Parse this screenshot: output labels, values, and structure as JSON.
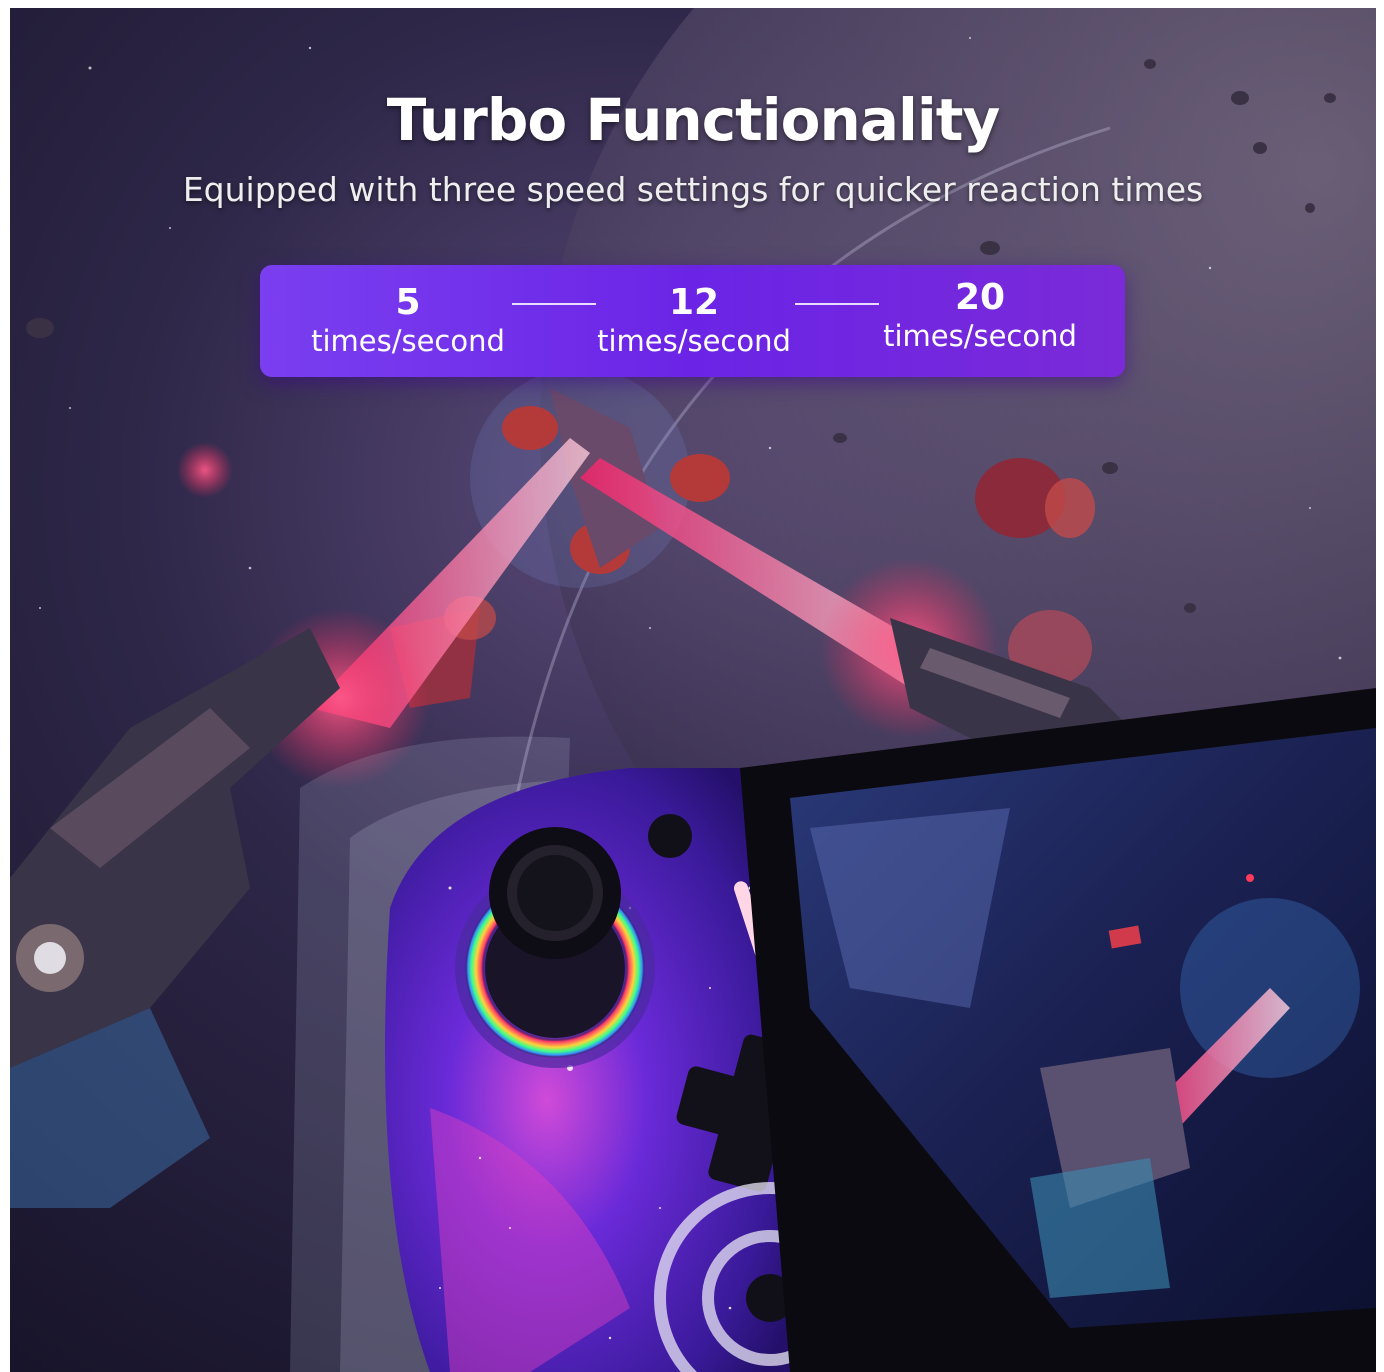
{
  "header": {
    "title": "Turbo Functionality",
    "subtitle": "Equipped with three speed settings for quicker reaction times"
  },
  "speed_settings": [
    {
      "value": "5",
      "unit": "times/second"
    },
    {
      "value": "12",
      "unit": "times/second"
    },
    {
      "value": "20",
      "unit": "times/second"
    }
  ],
  "colors": {
    "panel_purple": "#6b24e6",
    "laser_red": "#ff2a5a",
    "controller_violet": "#5a2ad0",
    "space_dark": "#1a1630"
  }
}
